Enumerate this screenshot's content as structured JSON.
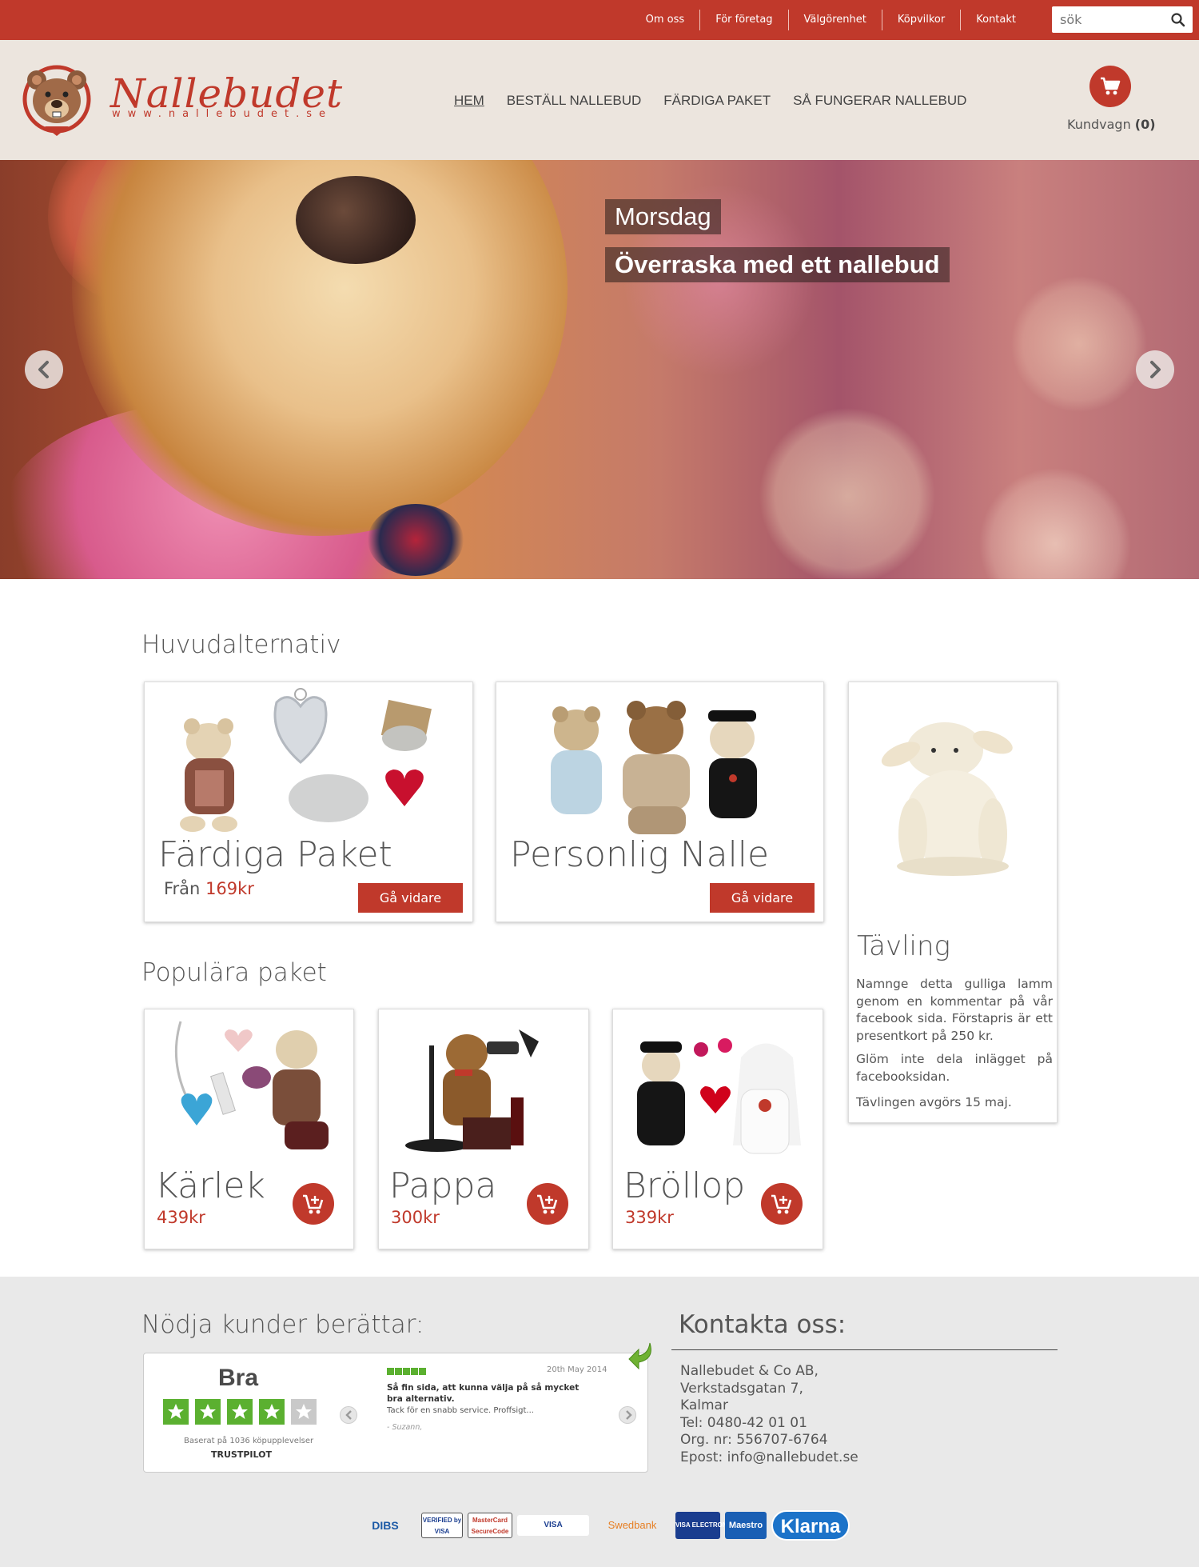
{
  "topbar": {
    "links": [
      "Om oss",
      "För företag",
      "Välgörenhet",
      "Köpvilkor",
      "Kontakt"
    ],
    "search_placeholder": "sök"
  },
  "header": {
    "logo_text": "Nallebudet",
    "logo_url": "www.nallebudet.se",
    "nav": [
      "HEM",
      "BESTÄLL NALLEBUD",
      "FÄRDIGA PAKET",
      "SÅ FUNGERAR NALLEBUD"
    ],
    "cart_label": "Kundvagn",
    "cart_count": "(0)"
  },
  "hero": {
    "caption1": "Morsdag",
    "caption2": "Överraska med ett nallebud"
  },
  "main": {
    "title": "Huvudalternativ",
    "cards": [
      {
        "title": "Färdiga Paket",
        "from_label": "Från",
        "from_price": "169kr",
        "button": "Gå vidare"
      },
      {
        "title": "Personlig Nalle",
        "button": "Gå vidare"
      }
    ],
    "contest": {
      "title": "Tävling",
      "p1": "Namnge detta gulliga lamm genom en kommentar på vår facebook sida. Förstapris är ett presentkort på 250 kr.",
      "p2": "Glöm inte dela inlägget på facebooksidan.",
      "p3": "Tävlingen avgörs 15 maj."
    }
  },
  "popular": {
    "title": "Populära paket",
    "items": [
      {
        "title": "Kärlek",
        "price": "439kr"
      },
      {
        "title": "Pappa",
        "price": "300kr"
      },
      {
        "title": "Bröllop",
        "price": "339kr"
      }
    ]
  },
  "footer": {
    "reviews_title": "Nödja kunder berättar:",
    "trustpilot": {
      "rating_word": "Bra",
      "stars": 4,
      "based_on": "Baserat på 1036 köpupplevelser",
      "logo": "TRUSTPILOT",
      "review_date": "20th May 2014",
      "review_title": "Så fin sida, att kunna välja på så mycket bra alternativ.",
      "review_body": "Tack för en snabb service. Proffsigt...",
      "review_author": "- Suzann,"
    },
    "contact_title": "Kontakta oss:",
    "contact_lines": [
      "Nallebudet & Co AB,",
      "Verkstadsgatan 7,",
      "Kalmar",
      "Tel: 0480-42 01 01",
      "Org. nr: 556707-6764",
      "Epost: info@nallebudet.se"
    ],
    "payments": [
      "DIBS",
      "VERIFIED by VISA",
      "MasterCard SecureCode",
      "VISA",
      "Swedbank",
      "VISA ELECTRON",
      "Maestro",
      "Klarna"
    ]
  },
  "colors": {
    "accent": "#c0392b",
    "header_bg": "#ece5de",
    "footer_bg": "#e9e9e9"
  }
}
